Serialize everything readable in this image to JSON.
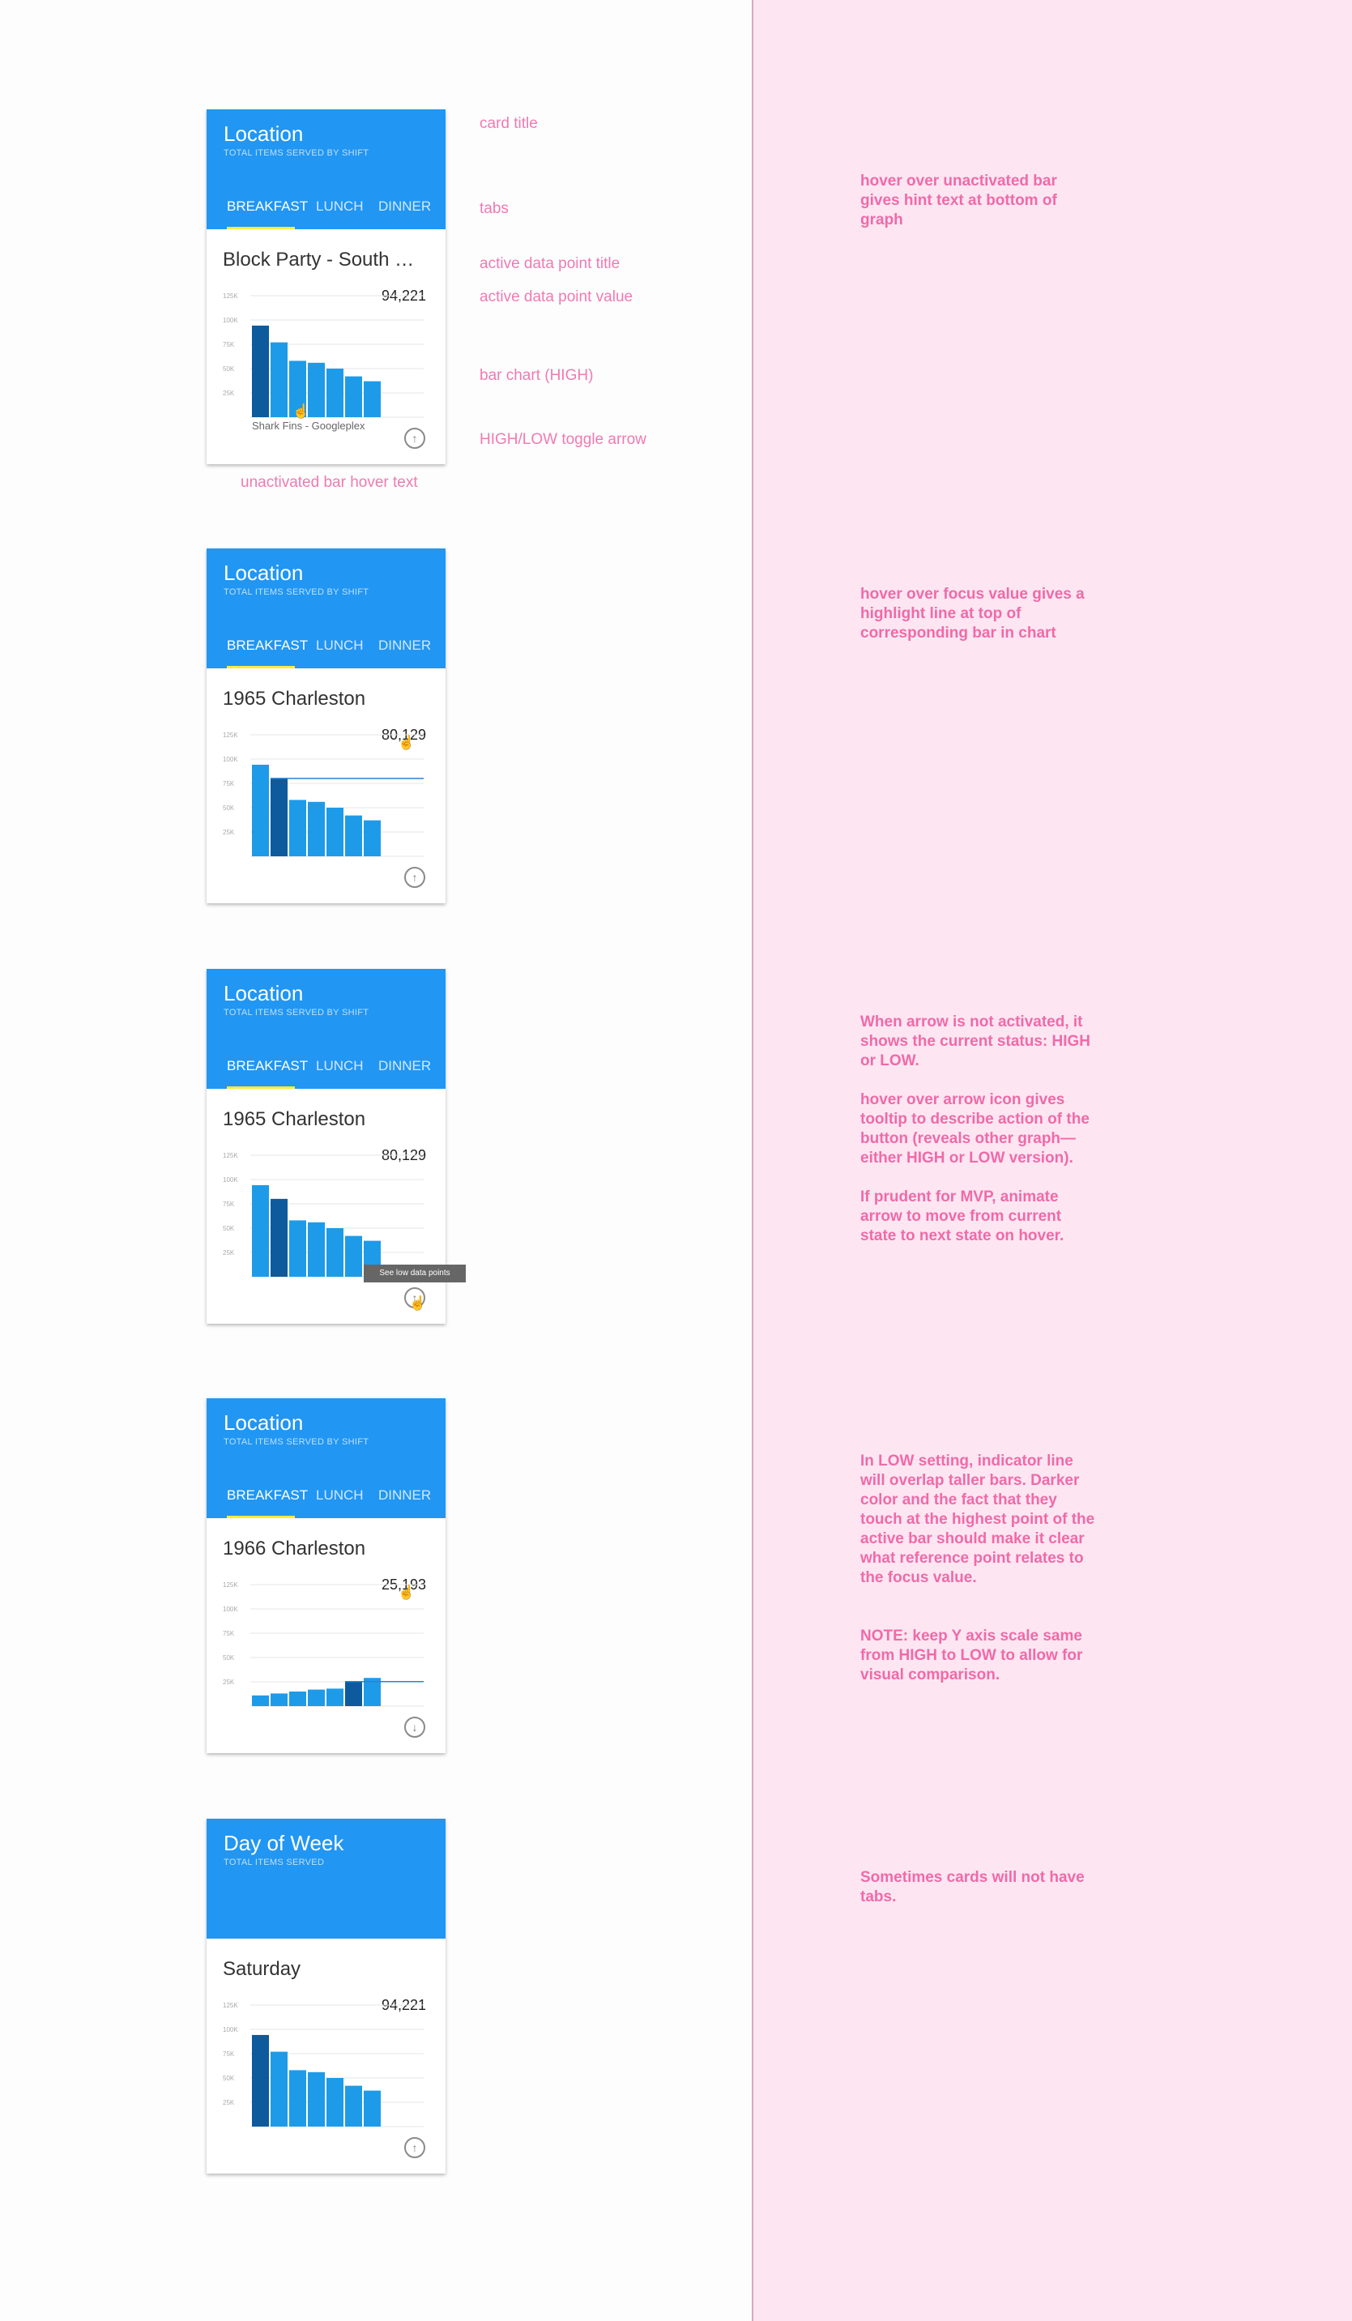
{
  "cards": [
    {
      "title": "Location",
      "subtitle": "TOTAL ITEMS SERVED BY SHIFT",
      "tabs": [
        "BREAKFAST",
        "LUNCH",
        "DINNER"
      ],
      "active_tab": 0,
      "data_point_title": "Block Party - South Carolina",
      "data_point_value": "94,221",
      "hint_text": "Shark Fins - Googleplex",
      "toggle_icon": "arrow-up-icon",
      "mode": "HIGH"
    },
    {
      "title": "Location",
      "subtitle": "TOTAL ITEMS SERVED BY SHIFT",
      "tabs": [
        "BREAKFAST",
        "LUNCH",
        "DINNER"
      ],
      "active_tab": 0,
      "data_point_title": "1965 Charleston",
      "data_point_value": "80,129",
      "toggle_icon": "arrow-up-icon",
      "mode": "HIGH"
    },
    {
      "title": "Location",
      "subtitle": "TOTAL ITEMS SERVED BY SHIFT",
      "tabs": [
        "BREAKFAST",
        "LUNCH",
        "DINNER"
      ],
      "active_tab": 0,
      "data_point_title": "1965 Charleston",
      "data_point_value": "80,129",
      "tooltip": "See low data points",
      "toggle_icon": "arrow-up-icon",
      "mode": "HIGH"
    },
    {
      "title": "Location",
      "subtitle": "TOTAL ITEMS SERVED BY SHIFT",
      "tabs": [
        "BREAKFAST",
        "LUNCH",
        "DINNER"
      ],
      "active_tab": 0,
      "data_point_title": "1966 Charleston",
      "data_point_value": "25,193",
      "toggle_icon": "arrow-down-icon",
      "mode": "LOW"
    },
    {
      "title": "Day of Week",
      "subtitle": "TOTAL ITEMS SERVED",
      "tabs": [],
      "data_point_title": "Saturday",
      "data_point_value": "94,221",
      "toggle_icon": "arrow-up-icon",
      "mode": "HIGH"
    }
  ],
  "chart_data": [
    {
      "type": "bar",
      "card": 1,
      "mode": "HIGH",
      "yticks": [
        "125K",
        "100K",
        "75K",
        "50K",
        "25K"
      ],
      "ylim": [
        0,
        125000
      ],
      "values": [
        94221,
        77000,
        58000,
        56000,
        50000,
        42000,
        37000
      ],
      "active_index": 0,
      "reference_line": false,
      "hover_index": 2
    },
    {
      "type": "bar",
      "card": 2,
      "mode": "HIGH",
      "yticks": [
        "125K",
        "100K",
        "75K",
        "50K",
        "25K"
      ],
      "ylim": [
        0,
        125000
      ],
      "values": [
        94221,
        80129,
        58000,
        56000,
        50000,
        42000,
        37000
      ],
      "active_index": 1,
      "reference_line": true
    },
    {
      "type": "bar",
      "card": 3,
      "mode": "HIGH",
      "yticks": [
        "125K",
        "100K",
        "75K",
        "50K",
        "25K"
      ],
      "ylim": [
        0,
        125000
      ],
      "values": [
        94221,
        80129,
        58000,
        56000,
        50000,
        42000,
        37000
      ],
      "active_index": 1,
      "reference_line": false
    },
    {
      "type": "bar",
      "card": 4,
      "mode": "LOW",
      "yticks": [
        "125K",
        "100K",
        "75K",
        "50K",
        "25K"
      ],
      "ylim": [
        0,
        125000
      ],
      "values": [
        11000,
        13000,
        15000,
        17000,
        18000,
        25193,
        29000
      ],
      "active_index": 5,
      "reference_line": true
    },
    {
      "type": "bar",
      "card": 5,
      "mode": "HIGH",
      "yticks": [
        "125K",
        "100K",
        "75K",
        "50K",
        "25K"
      ],
      "ylim": [
        0,
        125000
      ],
      "values": [
        94221,
        77000,
        58000,
        56000,
        50000,
        42000,
        37000
      ],
      "active_index": 0,
      "reference_line": false
    }
  ],
  "annotations": {
    "card_title": "card title",
    "tabs": "tabs",
    "active_title": "active data point title",
    "active_value": "active data point value",
    "bar_chart": "bar chart (HIGH)",
    "toggle": "HIGH/LOW toggle arrow",
    "hover_text": "unactivated bar hover text"
  },
  "notes": {
    "n1": "hover over unactivated bar gives hint text at bottom of graph",
    "n2": "hover over focus value gives a highlight line at top of corresponding bar in chart",
    "n3a": "When arrow is not activated, it shows the current status: HIGH or LOW.",
    "n3b": "hover over arrow icon gives tooltip to describe action of the button (reveals other graph—either HIGH or LOW version).",
    "n3c": "If prudent for MVP, animate arrow to move from current state to next state on hover.",
    "n4a": "In LOW setting, indicator line will overlap taller bars. Darker color and the fact that they touch at the highest point of the active bar should make it clear what reference point relates to the focus value.",
    "n4b": "NOTE: keep Y axis scale same from HIGH to LOW to allow for visual comparison.",
    "n5": "Sometimes cards will not have tabs."
  },
  "colors": {
    "header": "#2196f3",
    "bar": "#1e9be8",
    "bar_active": "#0d5a9c",
    "tab_indicator": "#ffeb3b",
    "note_text": "#f06aa8",
    "notes_bg": "#fde6f2"
  }
}
